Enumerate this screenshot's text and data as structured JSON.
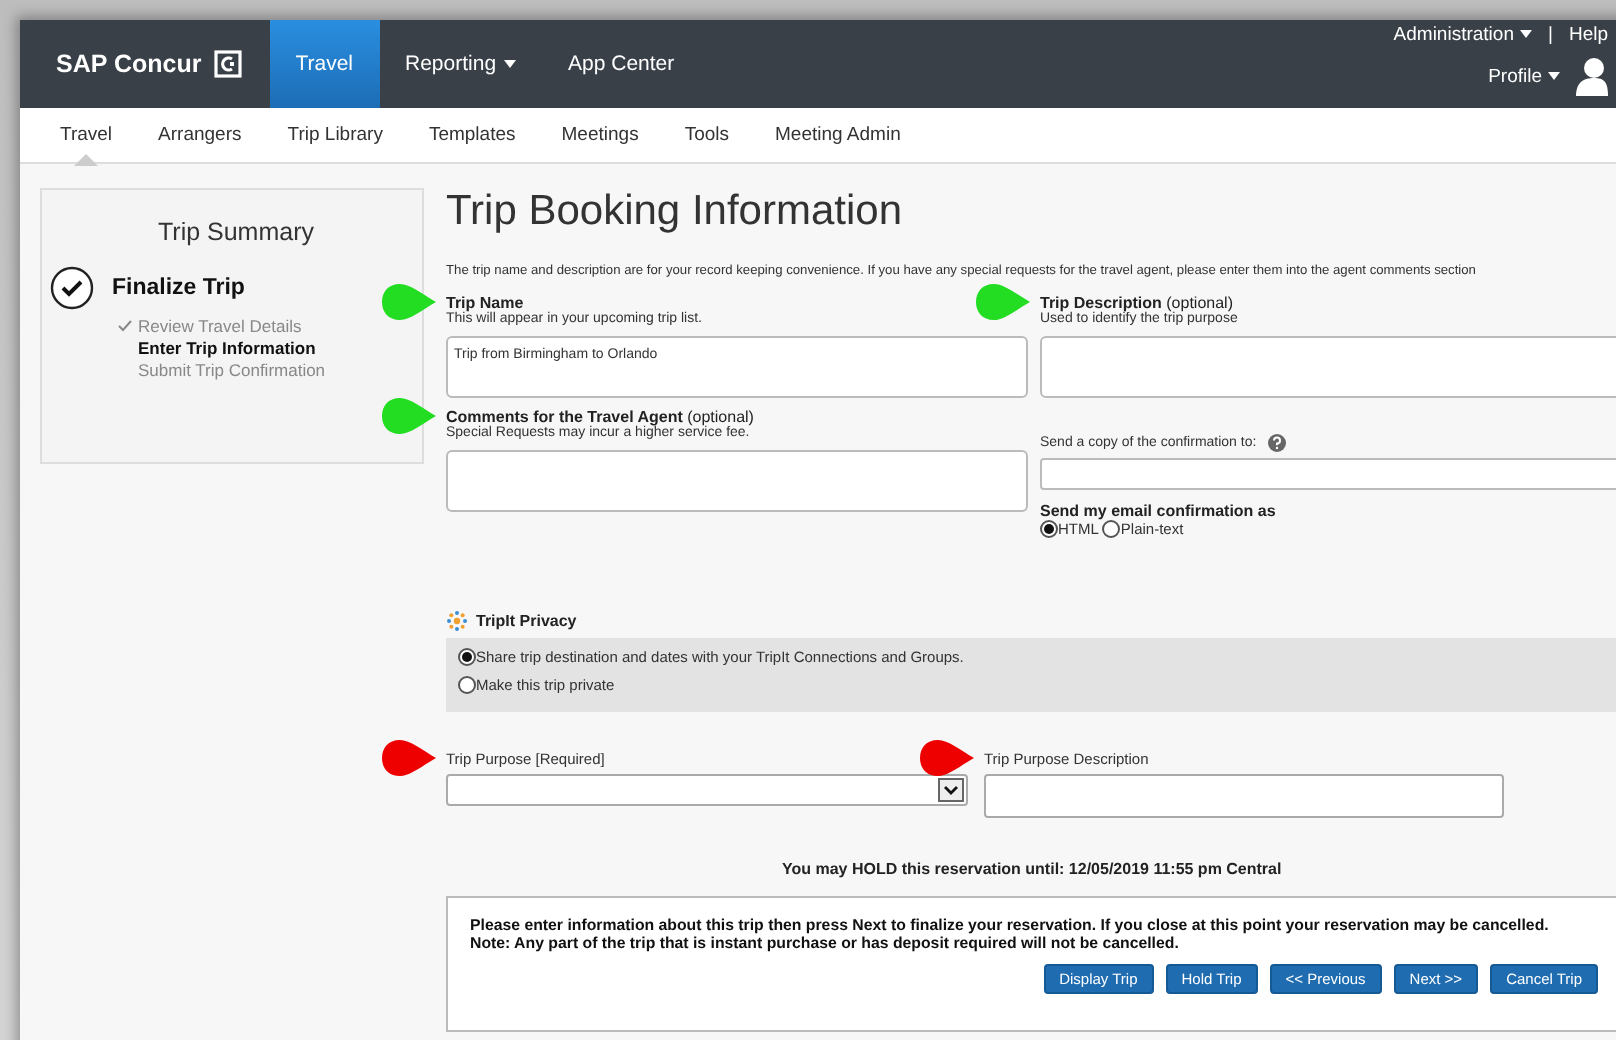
{
  "header": {
    "logo": "SAP Concur",
    "nav": [
      {
        "label": "Travel",
        "selected": true,
        "has_menu": false
      },
      {
        "label": "Reporting",
        "selected": false,
        "has_menu": true
      },
      {
        "label": "App Center",
        "selected": false,
        "has_menu": false
      }
    ],
    "admin_link": "Administration",
    "separator": "|",
    "help_link": "Help",
    "profile": "Profile"
  },
  "subnav": [
    {
      "label": "Travel",
      "selected": true
    },
    {
      "label": "Arrangers",
      "selected": false
    },
    {
      "label": "Trip Library",
      "selected": false
    },
    {
      "label": "Templates",
      "selected": false
    },
    {
      "label": "Meetings",
      "selected": false
    },
    {
      "label": "Tools",
      "selected": false
    },
    {
      "label": "Meeting Admin",
      "selected": false
    }
  ],
  "trip_summary": {
    "title": "Trip Summary",
    "step": "Finalize Trip",
    "substeps": [
      {
        "label": "Review Travel Details",
        "done": true,
        "current": false
      },
      {
        "label": "Enter Trip Information",
        "done": false,
        "current": true
      },
      {
        "label": "Submit Trip Confirmation",
        "done": false,
        "current": false
      }
    ]
  },
  "page_title": "Trip Booking Information",
  "intro": "The trip name and description are for your record keeping convenience. If you have any special requests for the travel agent, please enter them into the agent comments section",
  "trip_name": {
    "label": "**Trip Name**",
    "hint": "This will appear in your upcoming trip list.",
    "value": "Trip from Birmingham to Orlando",
    "marker": {
      "color": "#22dd22"
    }
  },
  "trip_description": {
    "label": "**Trip Description** (optional)",
    "hint": "Used to identify the trip purpose",
    "marker": {
      "color": "#22dd22"
    }
  },
  "agent_comments": {
    "label": "**Comments for the Travel Agent** (optional)",
    "hint": "Special Requests may incur a higher service fee.",
    "marker": {
      "color": "#22dd22"
    }
  },
  "copy_to": {
    "label": "Send a copy of the confirmation to:"
  },
  "email_format": {
    "label": "Send my email confirmation as",
    "options": [
      {
        "label": "HTML",
        "selected": true
      },
      {
        "label": "Plain-text",
        "selected": false
      }
    ]
  },
  "tripit": {
    "title": "TripIt Privacy",
    "options": [
      {
        "label": "Share trip destination and dates with your TripIt Connections and Groups.",
        "selected": true
      },
      {
        "label": "Make this trip private",
        "selected": false
      }
    ]
  },
  "trip_purpose": {
    "label": "Trip Purpose [Required]",
    "marker": {
      "color": "#ee0000"
    }
  },
  "trip_purpose_description": {
    "label": "Trip Purpose Description",
    "marker": {
      "color": "#ee0000"
    }
  },
  "hold_notice": "You may HOLD this reservation until: 12/05/2019 11:55 pm Central",
  "notice": [
    "Please enter information about this trip then press Next to finalize your reservation. If you close at this point your reservation may be cancelled.",
    "Note: Any part of the trip that is instant purchase or has deposit required will not be cancelled."
  ],
  "buttons": [
    "Display Trip",
    "Hold Trip",
    "<< Previous",
    "Next >>",
    "Cancel Trip"
  ]
}
